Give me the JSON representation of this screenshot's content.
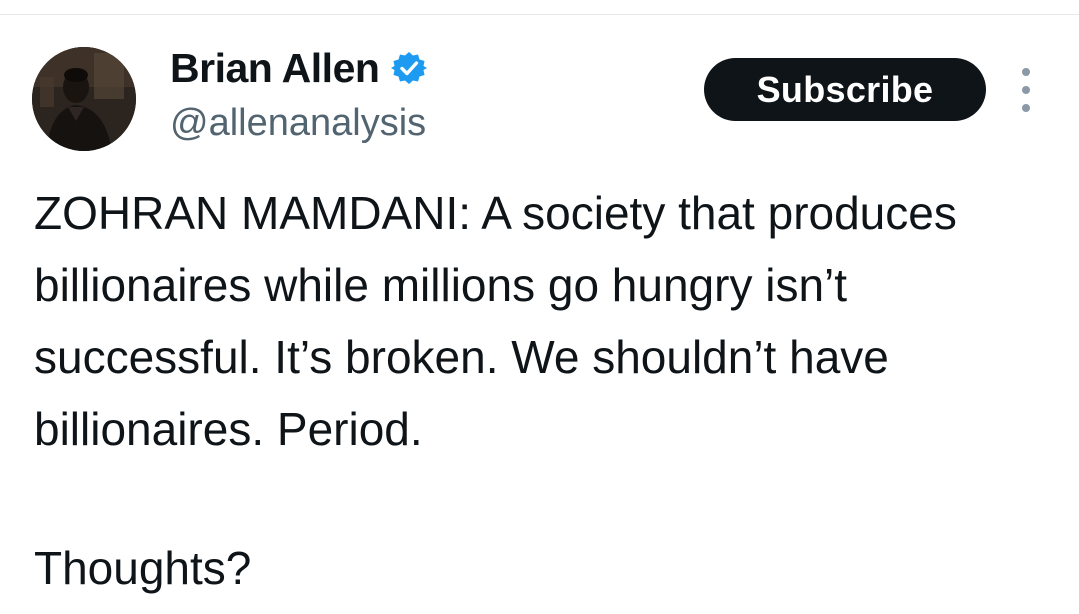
{
  "author": {
    "display_name": "Brian Allen",
    "handle": "@allenanalysis",
    "verified_icon": "verified-badge-icon",
    "avatar_icon": "profile-photo"
  },
  "actions": {
    "subscribe_label": "Subscribe",
    "more_icon": "vertical-ellipsis-icon"
  },
  "tweet": {
    "body": "ZOHRAN MAMDANI: A society that produces billionaires while millions go hungry isn’t successful. It’s broken. We shouldn’t have billionaires. Period.",
    "question": "Thoughts?"
  },
  "colors": {
    "text": "#0f1419",
    "secondary_text": "#536471",
    "verified": "#1d9bf0",
    "button_bg": "#0f1419",
    "button_text": "#ffffff"
  }
}
